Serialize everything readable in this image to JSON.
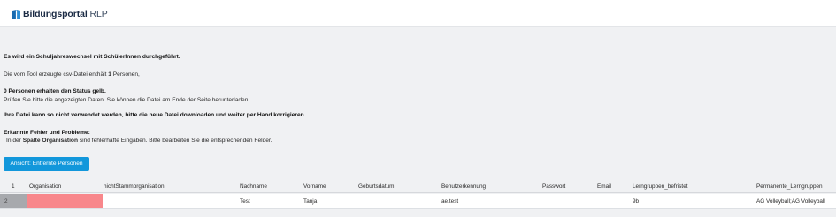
{
  "header": {
    "brand_bold": "Bildungsportal",
    "brand_rest": " RLP"
  },
  "messages": {
    "school_year_change": "Es wird ein Schuljahreswechsel mit SchülerInnen durchgeführt.",
    "csv_prefix": "Die vom Tool erzeugte csv-Datei enthält ",
    "csv_count": "1",
    "csv_suffix": " Personen,",
    "yellow_status": "0 Personen erhalten den Status gelb.",
    "check_data": "Prüfen Sie bitte die angezeigten Daten. Sie können die Datei am Ende der Seite herunterladen.",
    "cannot_use": "Ihre Datei kann so nicht verwendet werden, bitte die neue Datei downloaden und weiter per Hand korrigieren.",
    "errors_title": "Erkannte Fehler und Probleme:",
    "errors_prefix": "In der ",
    "errors_column": "Spalte Organisation",
    "errors_suffix": " sind fehlerhafte Eingaben. Bitte bearbeiten Sie die entsprechenden Felder."
  },
  "buttons": {
    "view_removed": "Ansicht: Entfernte Personen"
  },
  "table": {
    "headers": {
      "index": "1",
      "organisation": "Organisation",
      "nicht_stamm": "nichtStammorganisation",
      "nachname": "Nachname",
      "vorname": "Vorname",
      "geburtsdatum": "Geburtsdatum",
      "benutzerkennung": "Benutzerkennung",
      "passwort": "Passwort",
      "email": "Email",
      "lerngruppen_befristet": "Lerngruppen_befristet",
      "permanente_lerngruppen": "Permanente_Lerngruppen"
    },
    "rows": [
      {
        "index": "2",
        "organisation": "",
        "nicht_stamm": "",
        "nachname": "Test",
        "vorname": "Tanja",
        "geburtsdatum": "",
        "benutzerkennung": "ae.test",
        "passwort": "",
        "email": "",
        "lerngruppen_befristet": "9b",
        "permanente_lerngruppen": "AG Volleyball;AG Volleyball"
      }
    ]
  },
  "colors": {
    "primary_button": "#1297db",
    "error_cell": "#f8878b",
    "page_background": "#f0f1f3"
  }
}
